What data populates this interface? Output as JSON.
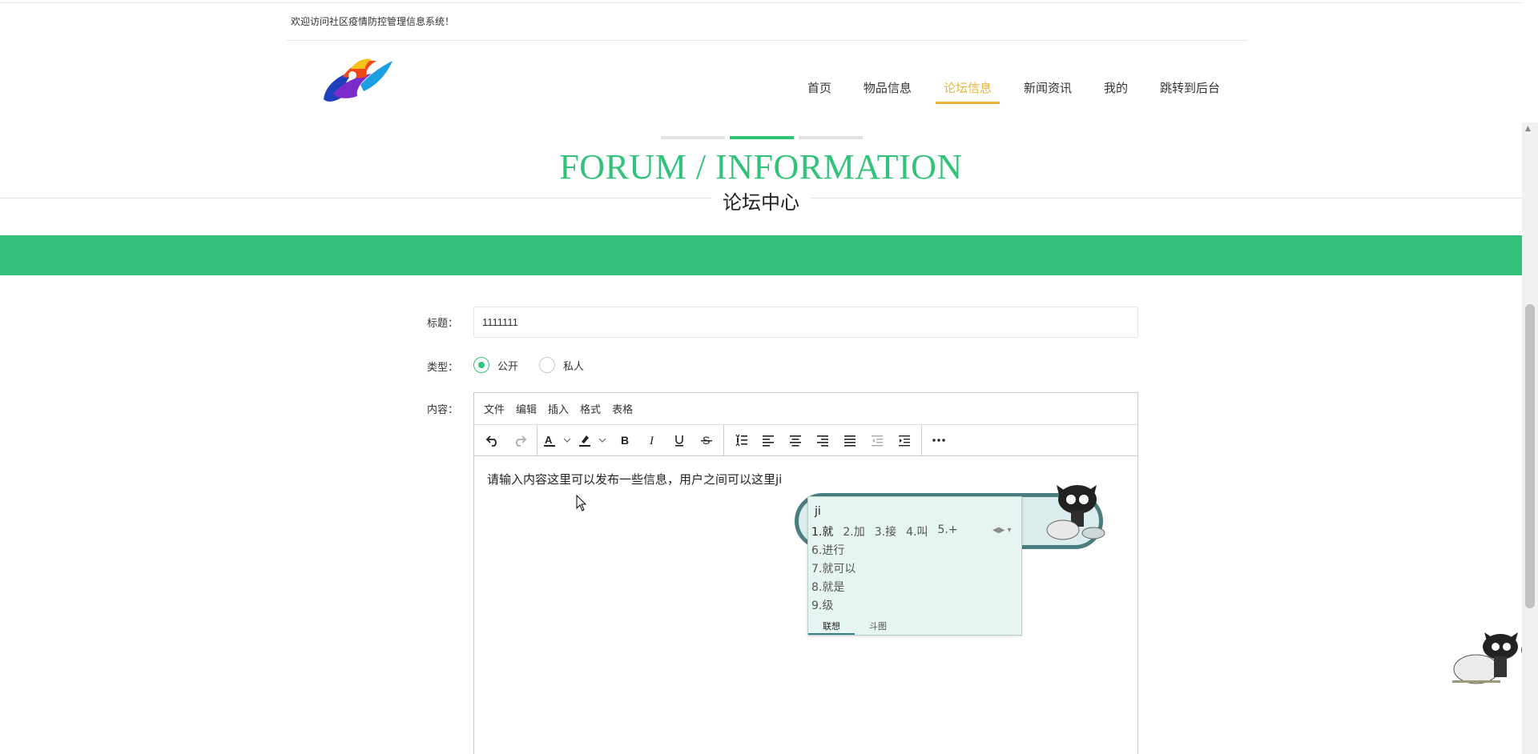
{
  "header": {
    "welcome": "欢迎访问社区疫情防控管理信息系统！"
  },
  "nav": {
    "items": [
      {
        "label": "首页"
      },
      {
        "label": "物品信息"
      },
      {
        "label": "论坛信息"
      },
      {
        "label": "新闻资讯"
      },
      {
        "label": "我的"
      },
      {
        "label": "跳转到后台"
      }
    ],
    "active_index": 2
  },
  "banner": {
    "title_en": "FORUM / INFORMATION",
    "title_zh": "论坛中心"
  },
  "form": {
    "title_label": "标题：",
    "title_value": "1111111",
    "type_label": "类型：",
    "type_options": [
      {
        "label": "公开",
        "checked": true
      },
      {
        "label": "私人",
        "checked": false
      }
    ],
    "content_label": "内容："
  },
  "editor": {
    "menu": [
      "文件",
      "编辑",
      "插入",
      "格式",
      "表格"
    ],
    "toolbar_icons": [
      "undo-icon",
      "redo-icon",
      "font-color-icon",
      "highlight-color-icon",
      "bold-icon",
      "italic-icon",
      "underline-icon",
      "strikethrough-icon",
      "line-height-icon",
      "align-left-icon",
      "align-center-icon",
      "align-right-icon",
      "justify-icon",
      "outdent-icon",
      "indent-icon",
      "more-icon"
    ],
    "content": "请输入内容这里可以发布一些信息，用户之间可以这里ji"
  },
  "ime": {
    "typed": "ji",
    "candidates_row": [
      "1.就",
      "2.加",
      "3.接",
      "4.叫",
      "5.+"
    ],
    "candidates_list": [
      "6.进行",
      "7.就可以",
      "8.就是",
      "9.级"
    ],
    "tabs": [
      "联想",
      "斗图"
    ]
  },
  "colors": {
    "accent": "#33c27a",
    "nav_active": "#e8b53a"
  }
}
